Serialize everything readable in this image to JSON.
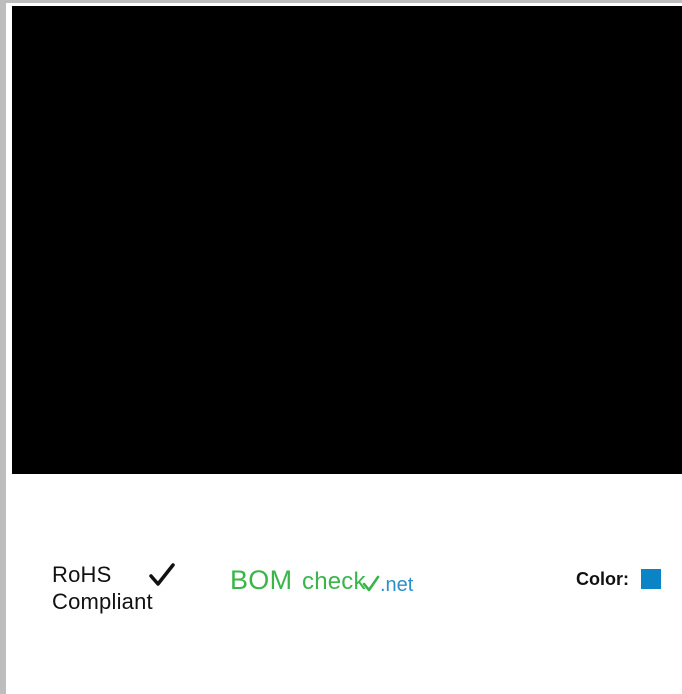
{
  "badges": {
    "rohs": {
      "line1": "RoHS",
      "line2": "Compliant",
      "check_icon": "check-mark-icon"
    },
    "bomcheck": {
      "main": "BOM",
      "check": "check",
      "net": ".net",
      "tick_icon": "green-check-icon",
      "main_color": "#3ab54a",
      "net_color": "#2b8fc9"
    }
  },
  "product": {
    "color_label": "Color:",
    "color_value": "#0b84c6"
  }
}
